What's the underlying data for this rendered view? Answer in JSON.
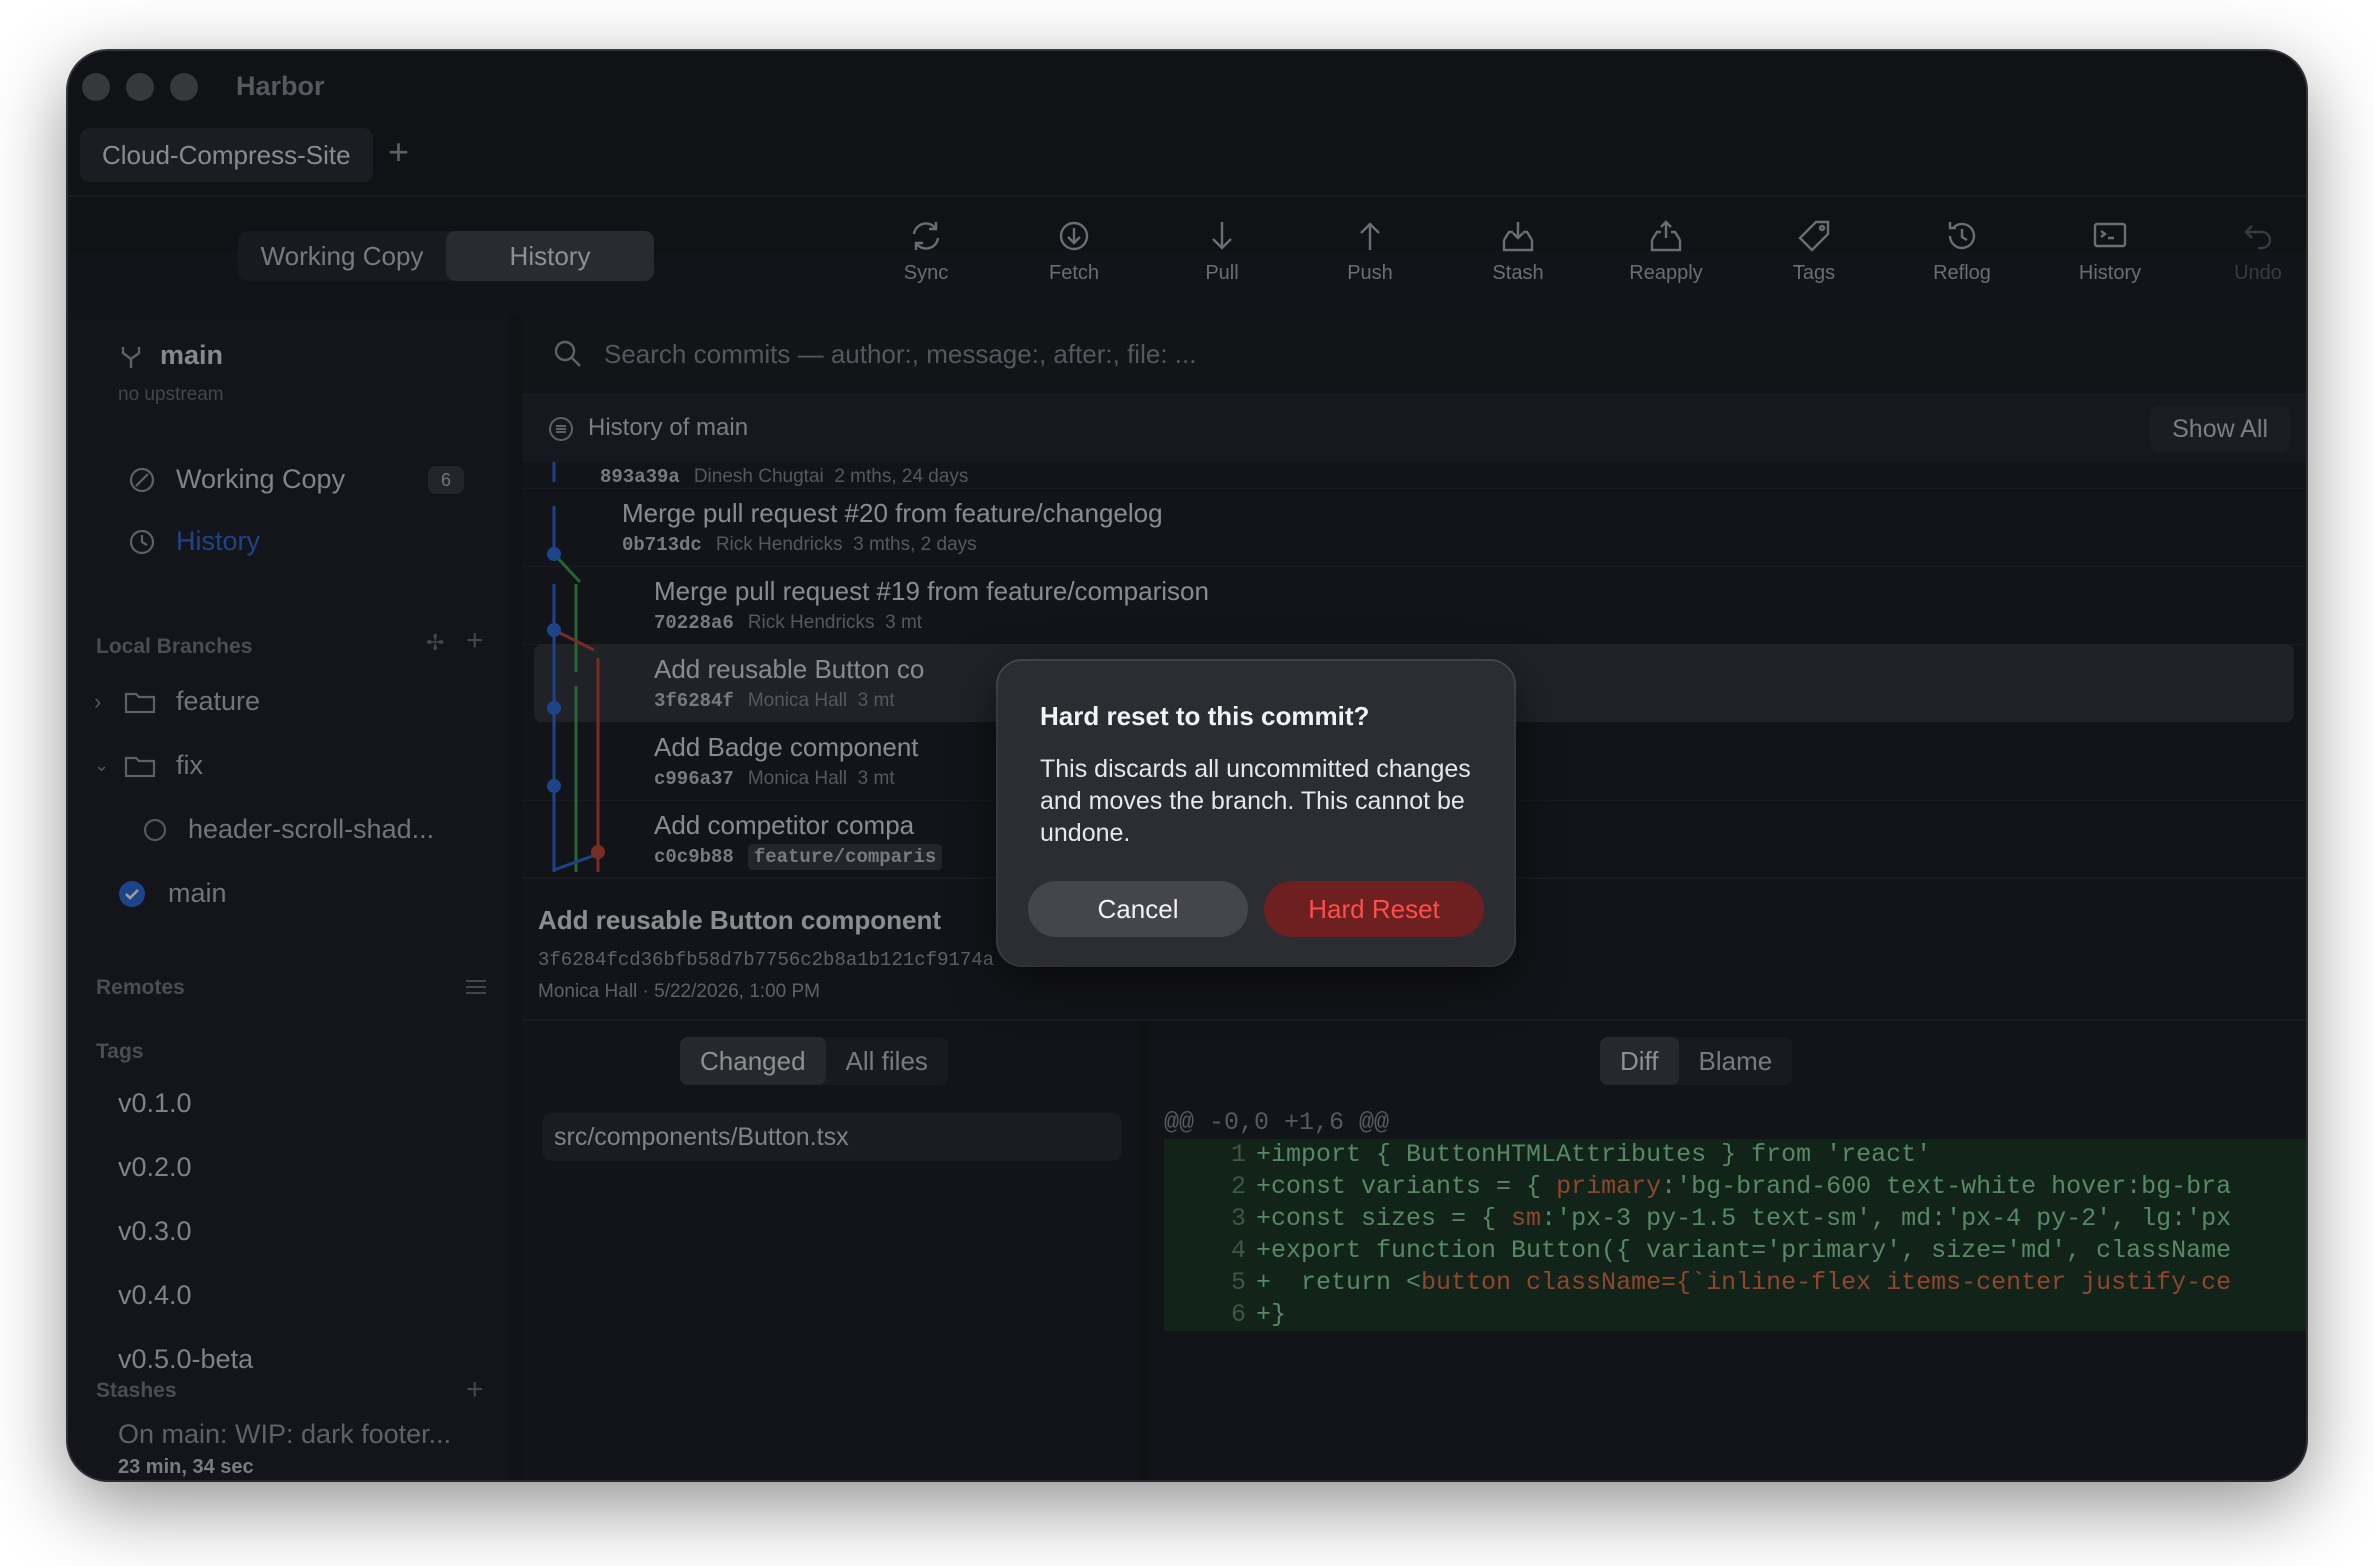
{
  "window": {
    "app_title": "Harbor"
  },
  "tabs": [
    {
      "label": "Cloud-Compress-Site"
    }
  ],
  "view_switch": {
    "working_copy": "Working Copy",
    "history": "History"
  },
  "toolbar": [
    {
      "label": "Sync",
      "icon": "sync-icon"
    },
    {
      "label": "Fetch",
      "icon": "fetch-icon"
    },
    {
      "label": "Pull",
      "icon": "pull-icon"
    },
    {
      "label": "Push",
      "icon": "push-icon"
    },
    {
      "label": "Stash",
      "icon": "stash-icon"
    },
    {
      "label": "Reapply",
      "icon": "reapply-icon"
    },
    {
      "label": "Tags",
      "icon": "tag-icon"
    },
    {
      "label": "Reflog",
      "icon": "reflog-icon"
    },
    {
      "label": "History",
      "icon": "terminal-icon"
    },
    {
      "label": "Undo",
      "icon": "undo-icon"
    }
  ],
  "sidebar": {
    "branch": "main",
    "upstream": "no upstream",
    "working_copy": "Working Copy",
    "working_copy_count": "6",
    "history": "History",
    "local_branches_header": "Local Branches",
    "folders": [
      {
        "name": "feature"
      },
      {
        "name": "fix"
      }
    ],
    "branches": [
      {
        "name": "header-scroll-shad..."
      },
      {
        "name": "main"
      }
    ],
    "remotes_header": "Remotes",
    "tags_header": "Tags",
    "tags": [
      "v0.1.0",
      "v0.2.0",
      "v0.3.0",
      "v0.4.0",
      "v0.5.0-beta"
    ],
    "stashes_header": "Stashes",
    "stash": {
      "text": "On main: WIP: dark footer...",
      "time": "23 min, 34 sec"
    }
  },
  "search": {
    "placeholder": "Search commits — author:, message:, after:, file: ..."
  },
  "history_header": {
    "title": "History of main",
    "show_all": "Show All"
  },
  "commits": [
    {
      "sha": "893a39a",
      "author": "Dinesh Chugtai",
      "age": "2 mths, 24 days",
      "message": ""
    },
    {
      "sha": "0b713dc",
      "author": "Rick Hendricks",
      "age": "3 mths, 2 days",
      "message": "Merge pull request #20 from feature/changelog"
    },
    {
      "sha": "70228a6",
      "author": "Rick Hendricks",
      "age": "3 mt",
      "message": "Merge pull request #19 from feature/comparison"
    },
    {
      "sha": "3f6284f",
      "author": "Monica Hall",
      "age": "3 mt",
      "message": "Add reusable Button co"
    },
    {
      "sha": "c996a37",
      "author": "Monica Hall",
      "age": "3 mt",
      "message": "Add Badge component"
    },
    {
      "sha": "c0c9b88",
      "author": "",
      "age": "",
      "ref": "feature/comparis",
      "message": "Add competitor compa"
    }
  ],
  "detail": {
    "title": "Add reusable Button component",
    "sha": "3f6284fcd36bfb58d7b7756c2b8a1b121cf9174a",
    "author_line": "Monica Hall · 5/22/2026, 1:00 PM"
  },
  "file_tabs": {
    "changed": "Changed",
    "all": "All files"
  },
  "files": [
    "src/components/Button.tsx"
  ],
  "diff_tabs": {
    "diff": "Diff",
    "blame": "Blame"
  },
  "diff": {
    "hunk": "@@ -0,0 +1,6 @@",
    "lines": [
      {
        "n": "1",
        "pre": "+import { ButtonHTMLAttributes } from 'react'",
        "str": "",
        "post": ""
      },
      {
        "n": "2",
        "pre": "+const variants = { ",
        "str": "primary",
        "post": ":'bg-brand-600 text-white hover:bg-bra"
      },
      {
        "n": "3",
        "pre": "+const sizes = { ",
        "str": "sm",
        "post": ":'px-3 py-1.5 text-sm', md:'px-4 py-2', lg:'px"
      },
      {
        "n": "4",
        "pre": "+export function Button({ variant='primary', size='md', classNam",
        "str": "",
        "post": "e"
      },
      {
        "n": "5",
        "pre": "+  return <",
        "str": "button className={`inline-flex items-center justify-ce",
        "post": ""
      },
      {
        "n": "6",
        "pre": "+}",
        "str": "",
        "post": ""
      }
    ]
  },
  "modal": {
    "title": "Hard reset to this commit?",
    "body": "This discards all uncommitted changes and moves the branch. This cannot be undone.",
    "cancel": "Cancel",
    "confirm": "Hard Reset"
  },
  "colors": {
    "accent_blue": "#2f6fdc",
    "danger": "#ff4d4d",
    "graph_blue": "#2f6fdc",
    "graph_green": "#3aa64f",
    "graph_red": "#c0483b"
  }
}
